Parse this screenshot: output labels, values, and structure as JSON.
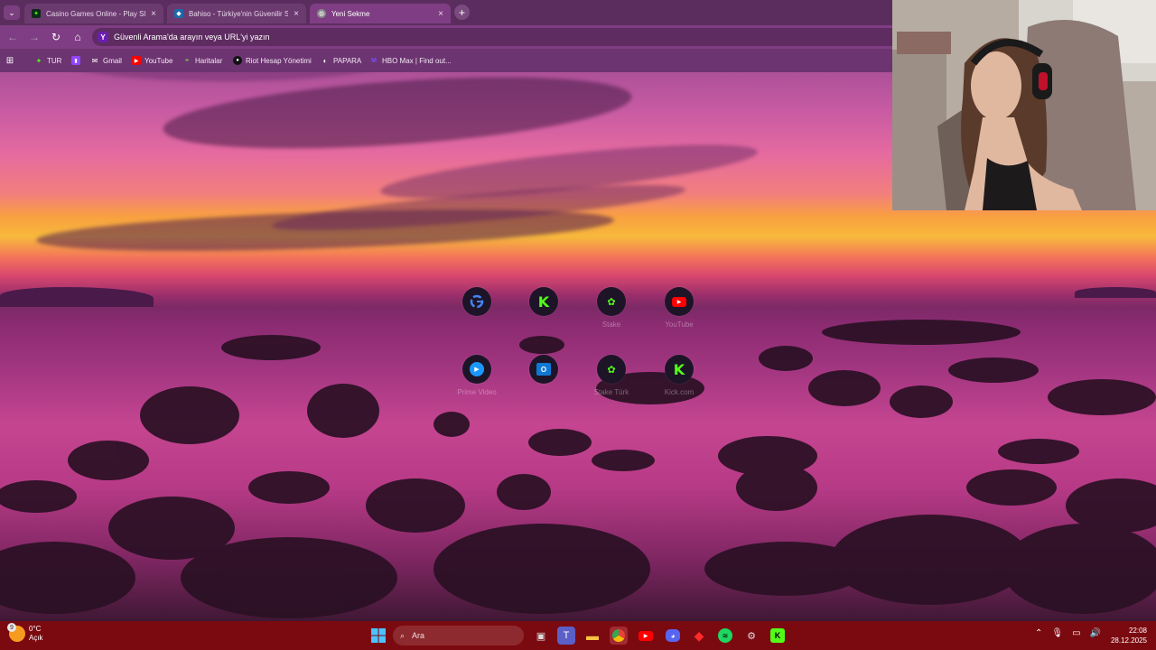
{
  "browser": {
    "tabs": [
      {
        "title": "Casino Games Online - Play Slo",
        "active": false,
        "favicon": "green-paw-icon"
      },
      {
        "title": "Bahiso - Türkiye'nin Güvenilir Si",
        "active": false,
        "favicon": "bahiso-icon"
      },
      {
        "title": "Yeni Sekme",
        "active": true,
        "favicon": "globe-icon"
      }
    ],
    "omnibox_placeholder": "Güvenli Arama'da arayın veya URL'yi yazın",
    "bookmarks": [
      {
        "label": "TUR",
        "icon": "kick-icon"
      },
      {
        "label": "",
        "icon": "twitch-icon"
      },
      {
        "label": "Gmail",
        "icon": "gmail-icon"
      },
      {
        "label": "YouTube",
        "icon": "youtube-icon"
      },
      {
        "label": "Haritalar",
        "icon": "maps-icon"
      },
      {
        "label": "Riot Hesap Yönetimi",
        "icon": "riot-icon"
      },
      {
        "label": "PAPARA",
        "icon": "papara-icon"
      },
      {
        "label": "HBO Max | Find out...",
        "icon": "hbo-icon"
      }
    ]
  },
  "shortcuts": [
    {
      "label": "",
      "icon": "google-icon"
    },
    {
      "label": "",
      "icon": "kick-icon"
    },
    {
      "label": "Stake",
      "icon": "green-paw-icon"
    },
    {
      "label": "YouTube",
      "icon": "youtube-icon"
    },
    {
      "label": "Prime Video",
      "icon": "prime-video-icon"
    },
    {
      "label": "",
      "icon": "outlook-icon"
    },
    {
      "label": "Stake Türk",
      "icon": "green-paw-icon"
    },
    {
      "label": "Kick.com",
      "icon": "kick-icon"
    }
  ],
  "taskbar": {
    "weather_temp": "0°C",
    "weather_desc": "Açık",
    "weather_badge": "9",
    "search_placeholder": "Ara",
    "time": "22:08",
    "date": "28.12.2025"
  },
  "colors": {
    "tabstrip": "#5b2d5e",
    "toolbar": "#7f3e83",
    "taskbar": "#7a0a10",
    "kick_green": "#53fc18"
  }
}
